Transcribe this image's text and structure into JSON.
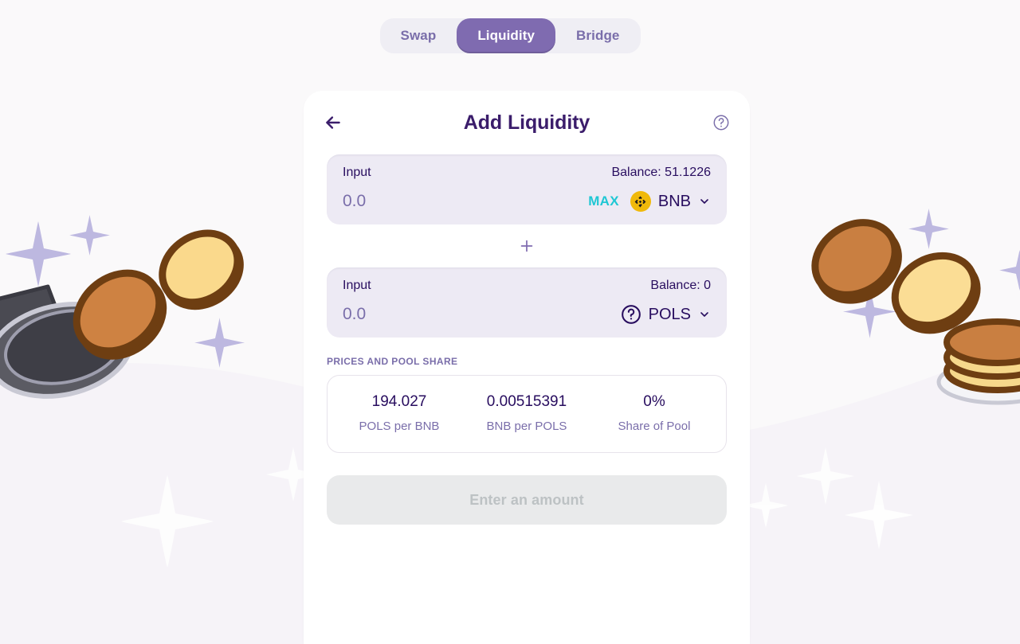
{
  "theme": {
    "page_bg": "#FAF9FA",
    "card_bg": "#FFFFFF",
    "input_panel_bg": "#EDEAF4",
    "primary_text": "#280D5F",
    "title_text": "#3B1D6B",
    "secondary_text": "#7A6EAA",
    "accent_active_tab": "#7F6BB0",
    "accent_max": "#1FC7D4",
    "bnb_yellow": "#F0B90B",
    "sparkle_purple": "#BDB8E0",
    "disabled_button_bg": "#E9EAEB",
    "disabled_button_text": "#BDC2C4"
  },
  "tabs": [
    {
      "label": "Swap",
      "active": false,
      "name": "tab-swap"
    },
    {
      "label": "Liquidity",
      "active": true,
      "name": "tab-liquidity"
    },
    {
      "label": "Bridge",
      "active": false,
      "name": "tab-bridge"
    }
  ],
  "card": {
    "title": "Add Liquidity",
    "back_icon": "arrow-left-icon",
    "help_icon": "question-circle-icon"
  },
  "inputs": [
    {
      "label": "Input",
      "balance": "Balance: 51.1226",
      "value": "",
      "placeholder": "0.0",
      "show_max": true,
      "max_label": "MAX",
      "token": "BNB",
      "token_icon": "bnb-coin-icon",
      "chevron": "chevron-down-icon"
    },
    {
      "label": "Input",
      "balance": "Balance: 0",
      "value": "",
      "placeholder": "0.0",
      "show_max": false,
      "max_label": "MAX",
      "token": "POLS",
      "token_icon": "unknown-token-icon",
      "chevron": "chevron-down-icon"
    }
  ],
  "separator_icon": "plus-icon",
  "prices": {
    "heading": "PRICES AND POOL SHARE",
    "columns": [
      {
        "value": "194.027",
        "caption": "POLS per BNB"
      },
      {
        "value": "0.00515391",
        "caption": "BNB per POLS"
      },
      {
        "value": "0%",
        "caption": "Share of Pool"
      }
    ]
  },
  "cta": {
    "label": "Enter an amount",
    "disabled": true
  }
}
